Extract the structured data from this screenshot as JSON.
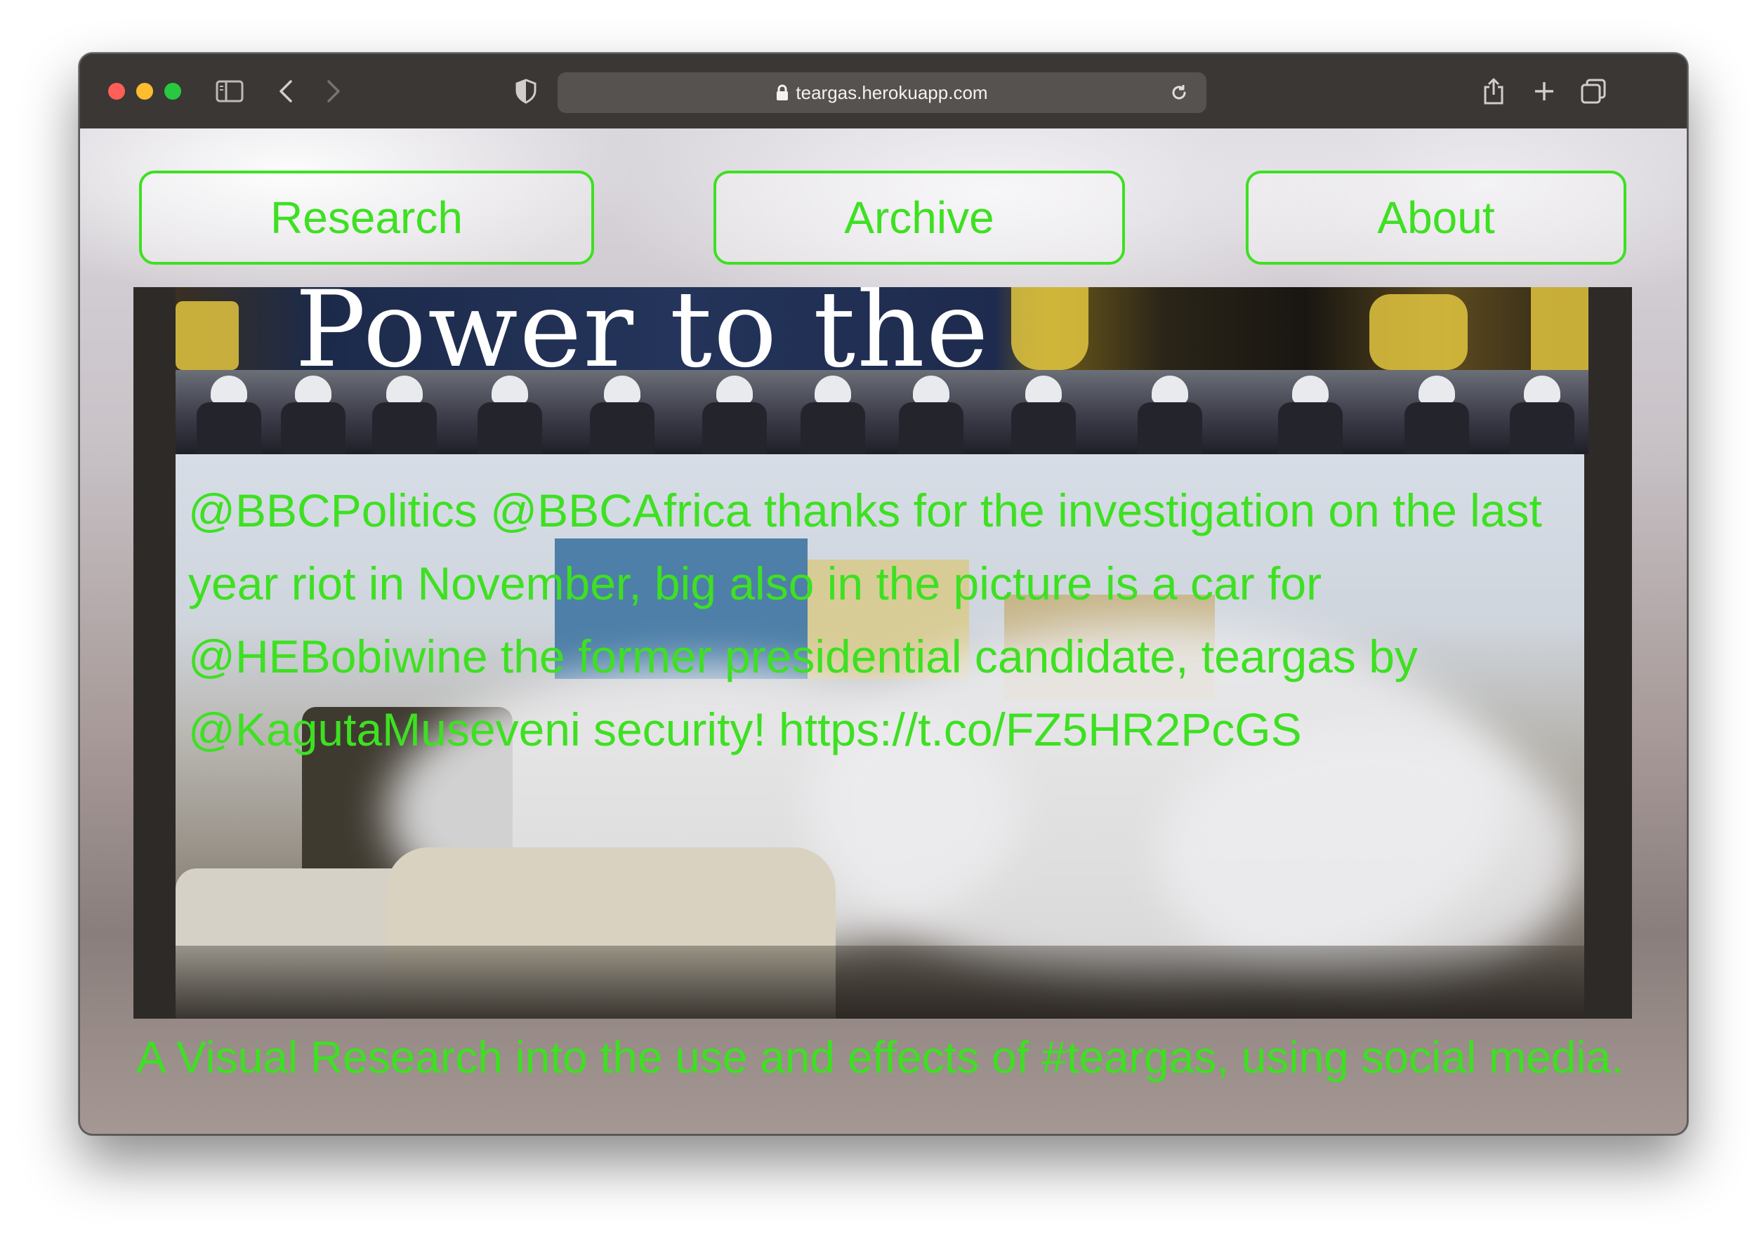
{
  "browser": {
    "url": "teargas.herokuapp.com",
    "icons": [
      "sidebar-icon",
      "back-icon",
      "forward-icon",
      "shield-icon",
      "lock-icon",
      "reload-icon",
      "share-icon",
      "new-tab-icon",
      "tabs-overview-icon"
    ]
  },
  "nav": {
    "research": "Research",
    "archive": "Archive",
    "about": "About"
  },
  "collage": {
    "banner_text": "Power to the"
  },
  "tweet": {
    "text": "@BBCPolitics @BBCAfrica thanks for the investigation on the last year riot in November, big also in the picture is a car for @HEBobiwine the former presidential candidate, teargas by @KagutaMuseveni security! https://t.co/FZ5HR2PcGS"
  },
  "footer": {
    "tagline": "A Visual Research into the use and effects of #teargas, using social media."
  },
  "colors": {
    "accent_green": "#3ee022",
    "titlebar": "#3a3735",
    "traffic_red": "#ff5f57",
    "traffic_yellow": "#febc2e",
    "traffic_green": "#28c840"
  }
}
